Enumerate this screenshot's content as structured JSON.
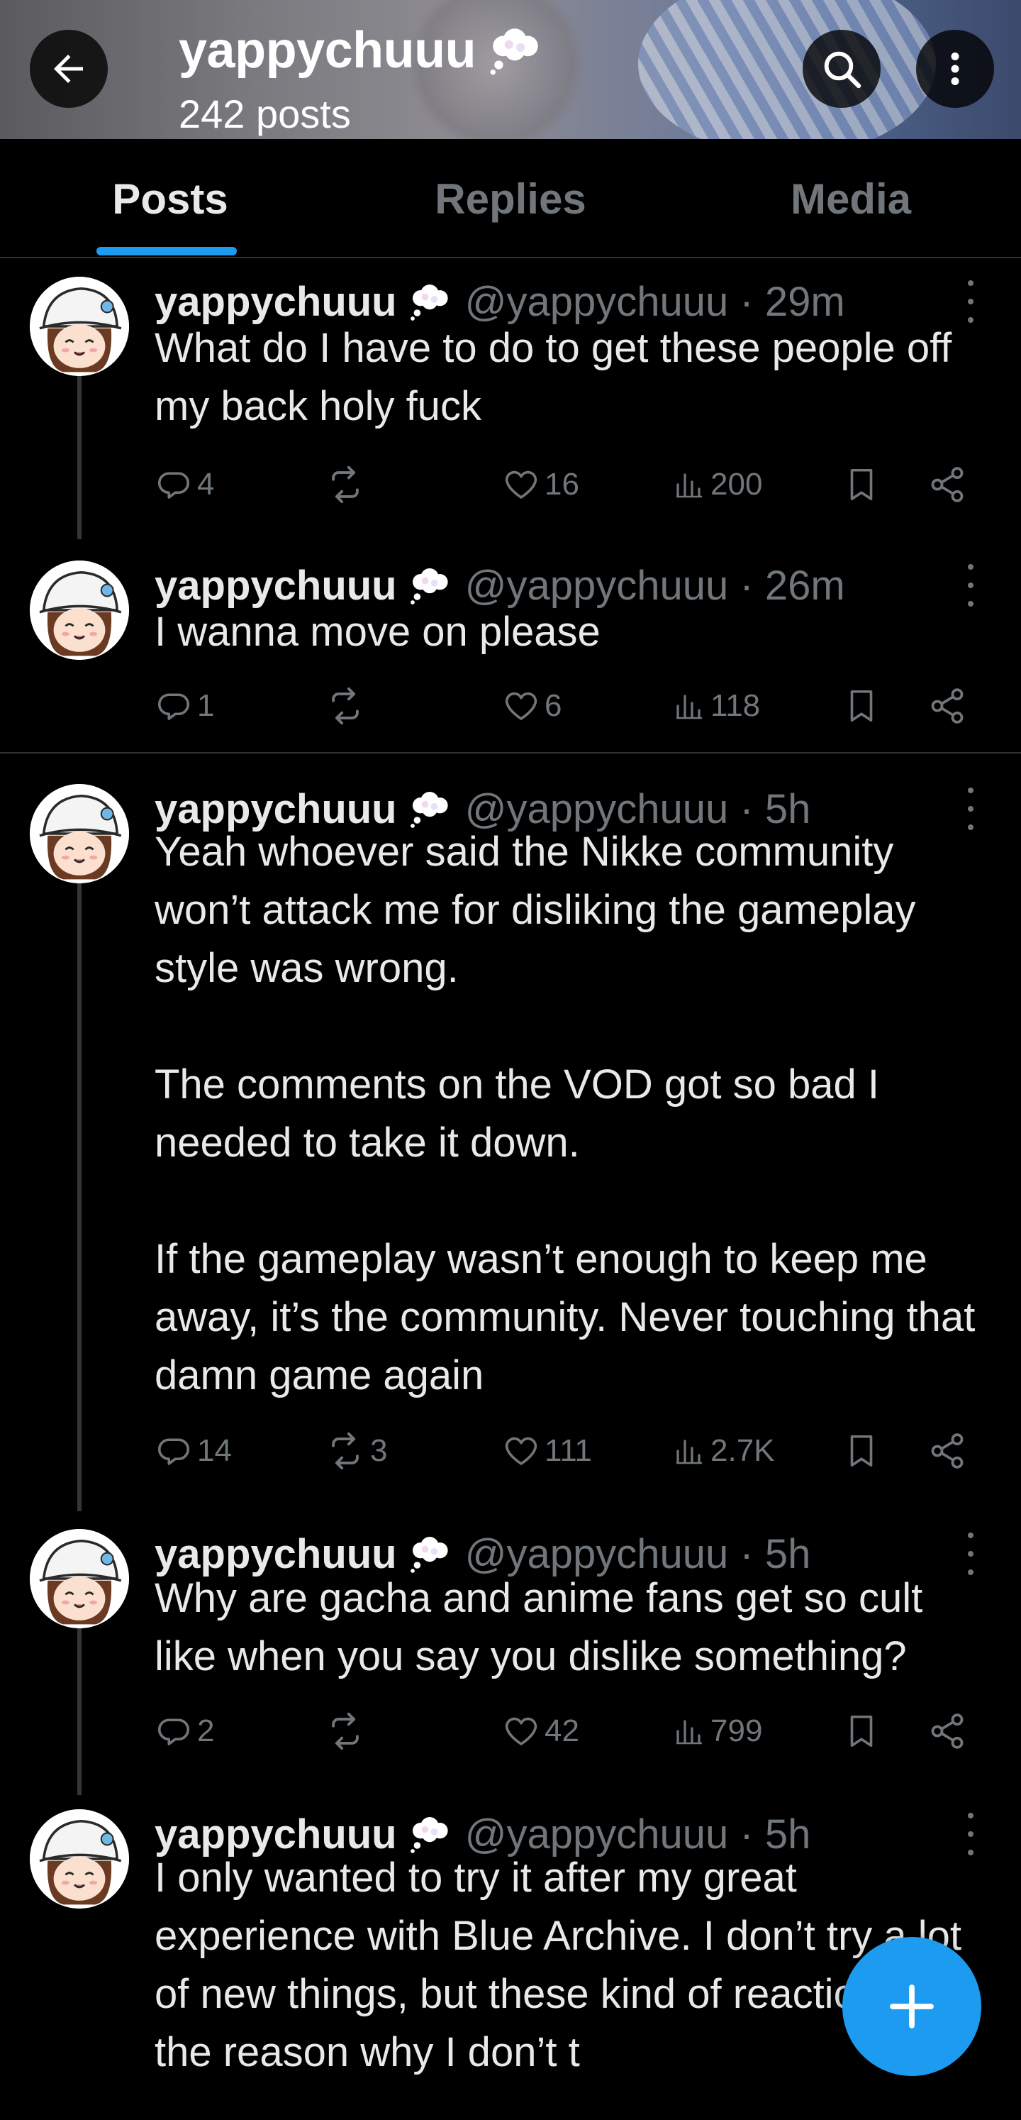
{
  "header": {
    "name": "yappychuuu",
    "posts_count": "242 posts"
  },
  "tabs": [
    {
      "label": "Posts",
      "active": true
    },
    {
      "label": "Replies",
      "active": false
    },
    {
      "label": "Media",
      "active": false
    }
  ],
  "posts": [
    {
      "name": "yappychuuu",
      "meta": "@yappychuuu · 29m",
      "text": "What do I have to do to get these people off my back holy fuck",
      "replies": "4",
      "reposts": "",
      "likes": "16",
      "views": "200"
    },
    {
      "name": "yappychuuu",
      "meta": "@yappychuuu · 26m",
      "text": "I wanna move on please",
      "replies": "1",
      "reposts": "",
      "likes": "6",
      "views": "118"
    },
    {
      "name": "yappychuuu",
      "meta": "@yappychuuu · 5h",
      "text": "Yeah whoever said the Nikke community won’t attack me for disliking the gameplay style was wrong.\n\nThe comments on the VOD got so bad I needed to take it down.\n\nIf the gameplay wasn’t enough to keep me away, it’s the community. Never touching that damn game again",
      "replies": "14",
      "reposts": "3",
      "likes": "111",
      "views": "2.7K"
    },
    {
      "name": "yappychuuu",
      "meta": "@yappychuuu · 5h",
      "text": "Why are gacha and anime fans get so cult like when you say you dislike something?",
      "replies": "2",
      "reposts": "",
      "likes": "42",
      "views": "799"
    },
    {
      "name": "yappychuuu",
      "meta": "@yappychuuu · 5h",
      "text": "I only wanted to try it after my great experience with Blue Archive. I don’t try a lot of new things, but these kind of reactions are the reason why I don’t t",
      "replies": "",
      "reposts": "",
      "likes": "",
      "views": ""
    }
  ],
  "icons": {
    "back": "arrow-left-icon",
    "search": "search-icon",
    "more": "more-vertical-icon",
    "name_badge": "thought-cloud-icon",
    "reply": "reply-icon",
    "repost": "repost-icon",
    "like": "heart-icon",
    "views": "views-chart-icon",
    "bookmark": "bookmark-icon",
    "share": "share-icon",
    "compose": "plus-icon"
  },
  "colors": {
    "accent": "#1d9bf0",
    "background": "#000000",
    "text_primary": "#e7e9ea",
    "text_secondary": "#71767b"
  }
}
